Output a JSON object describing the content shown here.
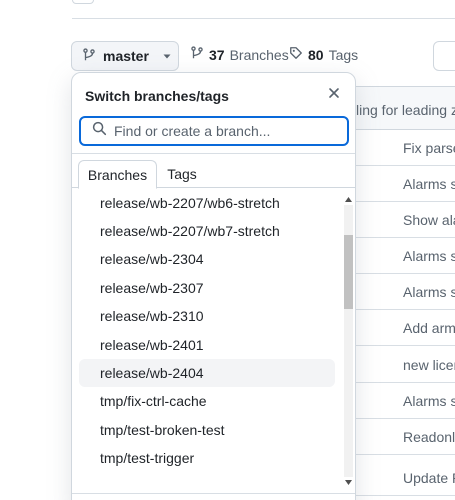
{
  "toolbar": {
    "branch_button_label": "master",
    "branches_count": "37",
    "branches_label": "Branches",
    "tags_count": "80",
    "tags_label": "Tags"
  },
  "background_table": {
    "header_fragment": "ling for leading z",
    "commit_fragments": [
      "Fix parse",
      "Alarms sc",
      "Show ala",
      "Alarms sc",
      "Alarms sc",
      "Add arme",
      "new licen",
      "Alarms sc",
      "Readonly",
      "Update R"
    ]
  },
  "dropdown": {
    "title": "Switch branches/tags",
    "search_placeholder": "Find or create a branch...",
    "tabs": [
      {
        "label": "Branches",
        "active": true
      },
      {
        "label": "Tags",
        "active": false
      }
    ],
    "items": [
      {
        "label": "release/wb-2207/wb6-stretch"
      },
      {
        "label": "release/wb-2207/wb7-stretch"
      },
      {
        "label": "release/wb-2304"
      },
      {
        "label": "release/wb-2307"
      },
      {
        "label": "release/wb-2310"
      },
      {
        "label": "release/wb-2401"
      },
      {
        "label": "release/wb-2404",
        "highlighted": true
      },
      {
        "label": "tmp/fix-ctrl-cache"
      },
      {
        "label": "tmp/test-broken-test"
      },
      {
        "label": "tmp/test-trigger"
      }
    ]
  },
  "colors": {
    "accent": "#0969da",
    "border": "#d0d7de",
    "muted_text": "#59636e",
    "highlight": "#f3f4f6"
  }
}
